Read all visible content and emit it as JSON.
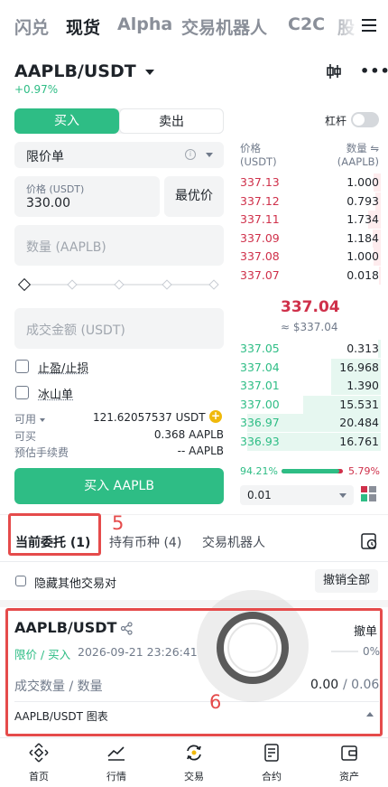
{
  "topnav": {
    "tabs": [
      {
        "label": "闪兑"
      },
      {
        "label": "现货"
      },
      {
        "label": "Alpha"
      },
      {
        "label": "交易机器人"
      },
      {
        "label": "C2C"
      },
      {
        "label": "股"
      }
    ]
  },
  "header": {
    "pair": "AAPLB/USDT",
    "change": "+0.97%"
  },
  "order_form": {
    "buy_label": "买入",
    "sell_label": "卖出",
    "leverage_label": "杠杆",
    "order_type": "限价单",
    "price_label": "价格 (USDT)",
    "price_value": "330.00",
    "best_price_label": "最优价",
    "amount_placeholder": "数量 (AAPLB)",
    "total_placeholder": "成交金额 (USDT)",
    "tpsl_label": "止盈/止损",
    "iceberg_label": "冰山单",
    "available_label": "可用",
    "available_value": "121.62057537 USDT",
    "can_buy_label": "可买",
    "can_buy_value": "0.368 AAPLB",
    "fee_label": "预估手续费",
    "fee_value": "-- AAPLB",
    "submit_label": "买入 AAPLB"
  },
  "orderbook": {
    "price_header": "价格",
    "price_unit": "(USDT)",
    "qty_header": "数量",
    "qty_unit": "(AAPLB)",
    "asks": [
      {
        "p": "337.13",
        "q": "1.000",
        "d": 0.05
      },
      {
        "p": "337.12",
        "q": "0.793",
        "d": 0.04
      },
      {
        "p": "337.11",
        "q": "1.734",
        "d": 0.09
      },
      {
        "p": "337.09",
        "q": "1.184",
        "d": 0.06
      },
      {
        "p": "337.08",
        "q": "1.000",
        "d": 0.05
      },
      {
        "p": "337.07",
        "q": "0.018",
        "d": 0.01
      }
    ],
    "last_price": "337.04",
    "last_price_usd": "≈ $337.04",
    "bids": [
      {
        "p": "337.05",
        "q": "0.313",
        "d": 0.02
      },
      {
        "p": "337.04",
        "q": "16.968",
        "d": 0.35
      },
      {
        "p": "337.01",
        "q": "1.390",
        "d": 0.35
      },
      {
        "p": "337.00",
        "q": "15.531",
        "d": 0.55
      },
      {
        "p": "336.97",
        "q": "20.484",
        "d": 0.95
      },
      {
        "p": "336.93",
        "q": "16.761",
        "d": 0.95
      }
    ],
    "buy_ratio": "94.21%",
    "sell_ratio": "5.79%",
    "buy_fraction": 0.9421,
    "depth": "0.01"
  },
  "orders_tabs": {
    "open": "当前委托 (1)",
    "holdings": "持有币种 (4)",
    "bots": "交易机器人"
  },
  "annotations": {
    "a5": "5",
    "a6": "6"
  },
  "filter": {
    "hide_label": "隐藏其他交易对",
    "cancel_all": "撤销全部"
  },
  "order_card": {
    "pair": "AAPLB/USDT",
    "cancel": "撤单",
    "type": "限价 / 买入",
    "time": "2026-09-21 23:26:41",
    "progress": "0%",
    "filled_label": "成交数量 / 数量",
    "filled_value": "0.00",
    "total_value": "/ 0.06",
    "chart_label": "AAPLB/USDT 图表"
  },
  "bottom_nav": [
    {
      "label": "首页"
    },
    {
      "label": "行情"
    },
    {
      "label": "交易"
    },
    {
      "label": "合约"
    },
    {
      "label": "资产"
    }
  ],
  "colors": {
    "green": "#2ebd85",
    "red": "#cf304a",
    "accent": "#f0b90b"
  }
}
